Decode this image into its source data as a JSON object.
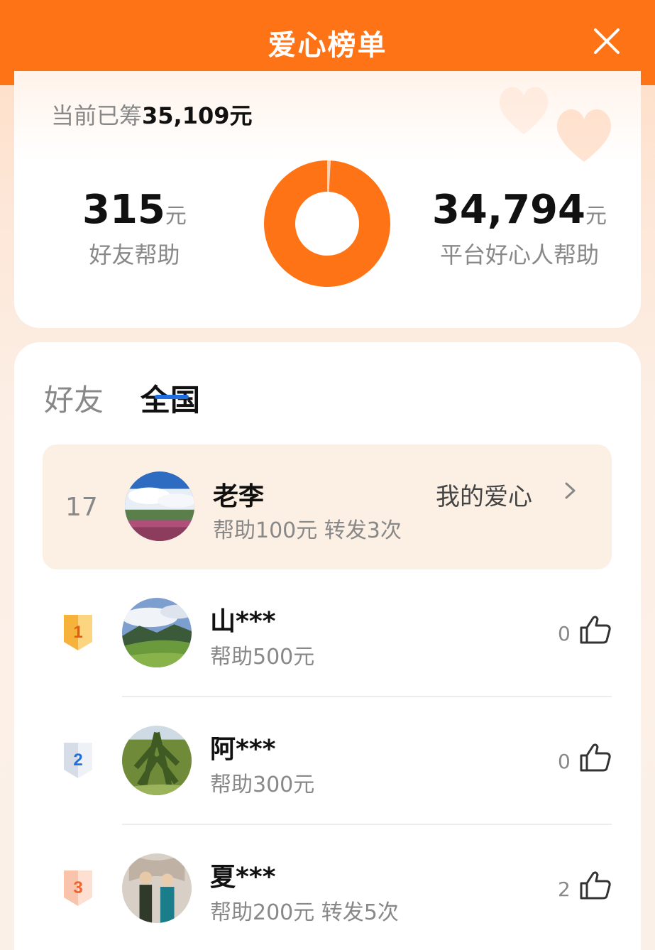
{
  "header": {
    "title": "爱心榜单"
  },
  "summary": {
    "raised_prefix": "当前已筹",
    "raised_amount": "35,109元",
    "friends": {
      "value": "315",
      "unit": "元",
      "label": "好友帮助"
    },
    "platform": {
      "value": "34,794",
      "unit": "元",
      "label": "平台好心人帮助"
    }
  },
  "chart_data": {
    "type": "pie",
    "categories": [
      "好友帮助",
      "平台好心人帮助"
    ],
    "values": [
      315,
      34794
    ],
    "colors": [
      "#f6d5bf",
      "#ff7317"
    ]
  },
  "tabs": [
    {
      "label": "好友"
    },
    {
      "label": "全国"
    }
  ],
  "my_entry": {
    "rank": "17",
    "name": "老李",
    "detail": "帮助100元 转发3次",
    "link_label": "我的爱心"
  },
  "leaderboard": [
    {
      "rank": "1",
      "name": "山***",
      "detail": "帮助500元",
      "likes": "0"
    },
    {
      "rank": "2",
      "name": "阿***",
      "detail": "帮助300元",
      "likes": "0"
    },
    {
      "rank": "3",
      "name": "夏***",
      "detail": "帮助200元 转发5次",
      "likes": "2"
    }
  ],
  "colors": {
    "brand": "#ff7317",
    "tab_indicator": "#1f6fe0",
    "gold": "#f7b23b",
    "silver": "#1f6fe0",
    "bronze": "#f0632d"
  }
}
